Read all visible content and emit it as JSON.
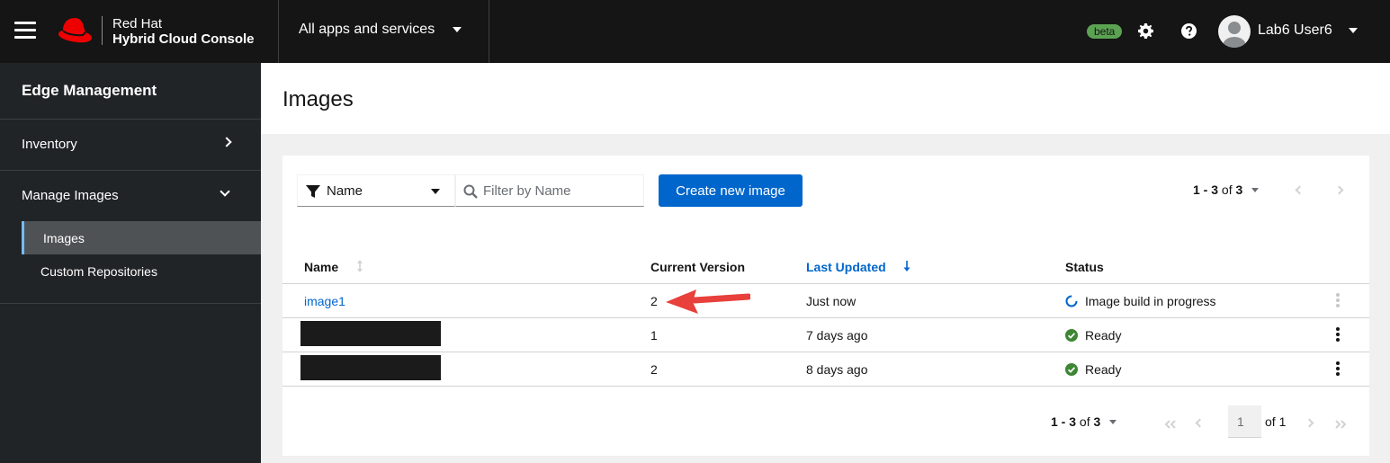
{
  "masthead": {
    "brand_line1": "Red Hat",
    "brand_line2": "Hybrid Cloud Console",
    "apps_label": "All apps and services",
    "beta_label": "beta",
    "user_name": "Lab6 User6"
  },
  "sidebar": {
    "title": "Edge Management",
    "items": [
      {
        "label": "Inventory",
        "expanded": false
      },
      {
        "label": "Manage Images",
        "expanded": true
      }
    ],
    "sub_items": [
      {
        "label": "Images",
        "active": true
      },
      {
        "label": "Custom Repositories",
        "active": false
      }
    ]
  },
  "page": {
    "title": "Images"
  },
  "toolbar": {
    "filter_attribute": "Name",
    "search_placeholder": "Filter by Name",
    "create_label": "Create new image"
  },
  "pagination_top": {
    "range": "1 - 3",
    "of_label": "of",
    "total": "3"
  },
  "table": {
    "columns": [
      "Name",
      "Current Version",
      "Last Updated",
      "Status"
    ],
    "sorted_column": "Last Updated",
    "rows": [
      {
        "name": "image1",
        "version": "2",
        "updated": "Just now",
        "status": "Image build in progress",
        "status_type": "in-progress"
      },
      {
        "name": "",
        "version": "1",
        "updated": "7 days ago",
        "status": "Ready",
        "status_type": "ready"
      },
      {
        "name": "",
        "version": "2",
        "updated": "8 days ago",
        "status": "Ready",
        "status_type": "ready"
      }
    ]
  },
  "pagination_bottom": {
    "range": "1 - 3",
    "of_label": "of",
    "total": "3",
    "current_page": "1",
    "page_of": "of 1"
  },
  "colors": {
    "masthead": "#151515",
    "sidebar": "#212427",
    "primary": "#0066cc",
    "success": "#3e8635",
    "beta": "#5ba352",
    "annotation_arrow": "#e8403a"
  },
  "icons": [
    "hamburger-icon",
    "redhat-logo",
    "gear-icon",
    "help-icon",
    "avatar",
    "filter-icon",
    "search-icon",
    "sort-icon",
    "sort-down-icon",
    "spinner-icon",
    "check-circle-icon",
    "kebab-icon",
    "chevron-right-icon",
    "chevron-down-icon"
  ]
}
